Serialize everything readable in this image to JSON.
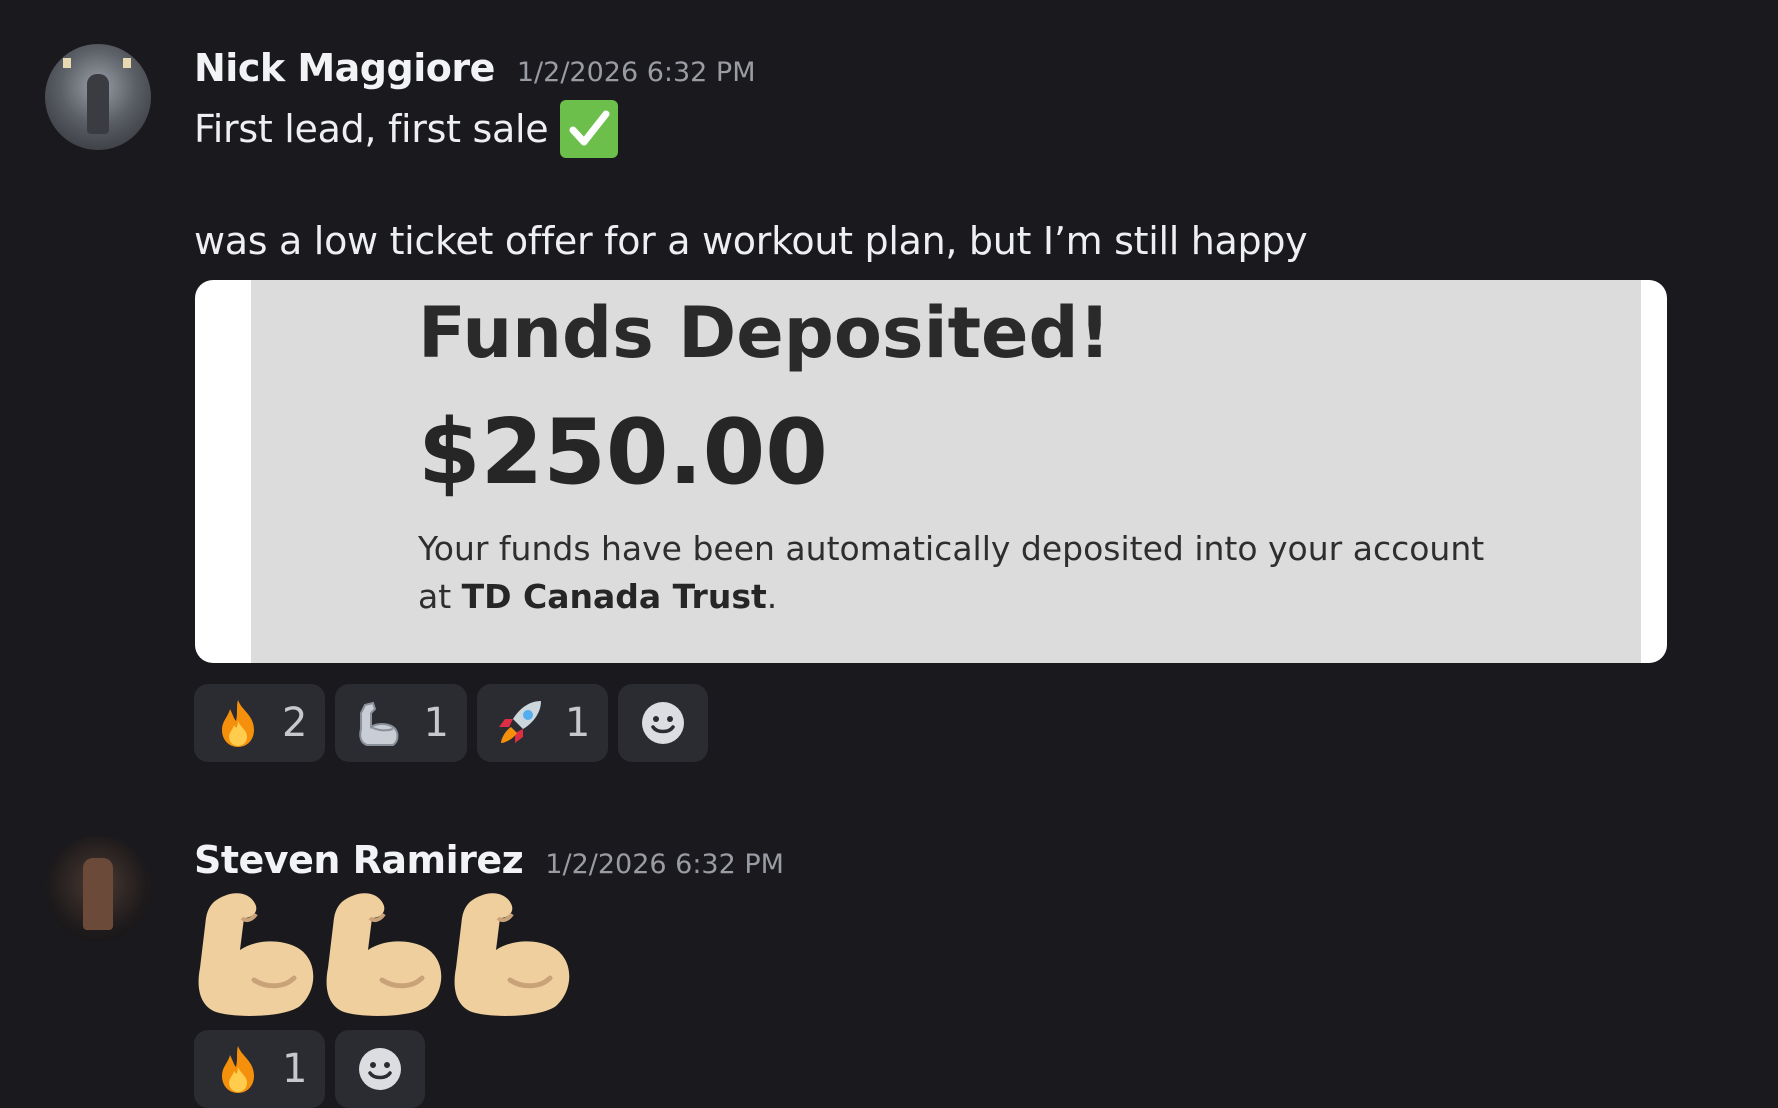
{
  "messages": [
    {
      "username": "Nick Maggiore",
      "timestamp": "1/2/2026 6:32 PM",
      "text_line1": "First lead, first sale",
      "text_line1_emoji": "white-check-mark-icon",
      "text_line2": "was a low ticket offer for a workout plan, but I’m  still happy",
      "embed": {
        "title": "Funds Deposited!",
        "amount": "$250.00",
        "description_prefix": "Your funds have been automatically deposited into your account at ",
        "bank": "TD Canada Trust",
        "description_suffix": "."
      },
      "reactions": [
        {
          "emoji": "fire-icon",
          "count": "2"
        },
        {
          "emoji": "mechanical-arm-icon",
          "count": "1"
        },
        {
          "emoji": "rocket-icon",
          "count": "1"
        }
      ]
    },
    {
      "username": "Steven Ramirez",
      "timestamp": "1/2/2026 6:32 PM",
      "content_emojis": [
        "flexed-biceps-icon",
        "flexed-biceps-icon",
        "flexed-biceps-icon"
      ],
      "reactions": [
        {
          "emoji": "fire-icon",
          "count": "1"
        }
      ]
    }
  ],
  "colors": {
    "background": "#1a1a1e",
    "reaction_bg": "#2b2c31",
    "check_green": "#6cbf4b",
    "embed_bg": "#dcdcdc"
  }
}
